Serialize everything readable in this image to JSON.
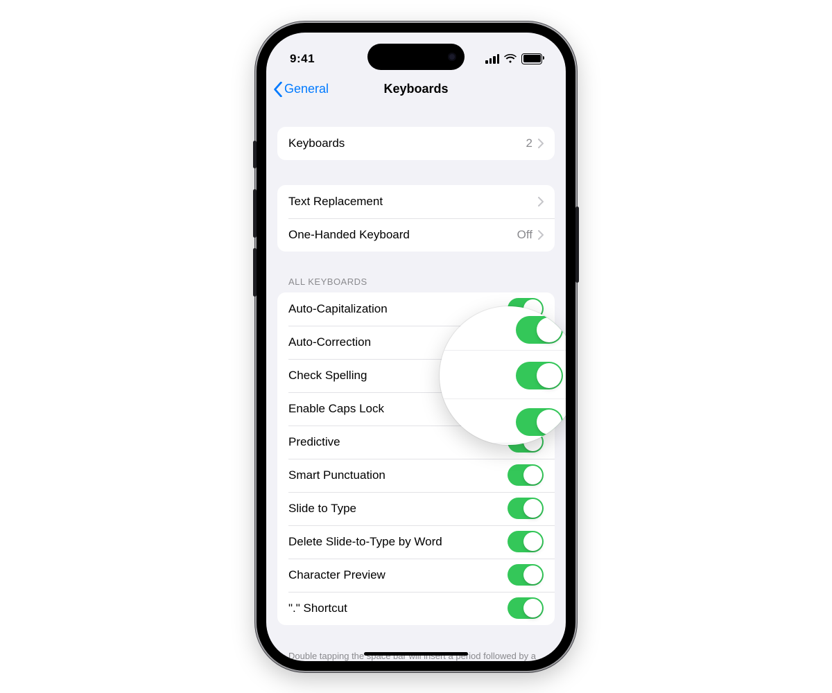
{
  "status": {
    "time": "9:41"
  },
  "nav": {
    "back_label": "General",
    "title": "Keyboards"
  },
  "sections": {
    "main": {
      "keyboards": {
        "label": "Keyboards",
        "value": "2"
      },
      "text_replacement": {
        "label": "Text Replacement"
      },
      "one_handed": {
        "label": "One-Handed Keyboard",
        "value": "Off"
      }
    },
    "all_keyboards": {
      "header": "ALL KEYBOARDS",
      "items": [
        {
          "label": "Auto-Capitalization",
          "on": true
        },
        {
          "label": "Auto-Correction",
          "on": true
        },
        {
          "label": "Check Spelling",
          "on": true
        },
        {
          "label": "Enable Caps Lock",
          "on": true
        },
        {
          "label": "Predictive",
          "on": true
        },
        {
          "label": "Smart Punctuation",
          "on": true
        },
        {
          "label": "Slide to Type",
          "on": true
        },
        {
          "label": "Delete Slide-to-Type by Word",
          "on": true
        },
        {
          "label": "Character Preview",
          "on": true
        },
        {
          "label": "\".\" Shortcut",
          "on": true
        }
      ],
      "footer": "Double tapping the space bar will insert a period followed by a space."
    }
  }
}
